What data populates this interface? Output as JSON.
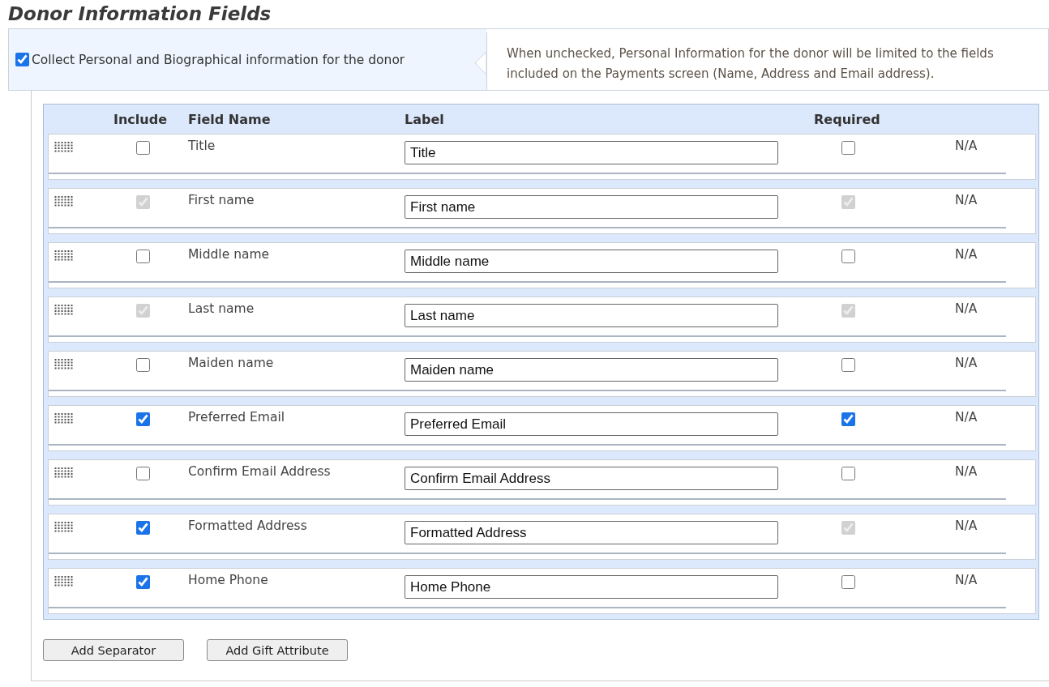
{
  "title": "Donor Information Fields",
  "collect_option": {
    "label": "Collect Personal and Biographical information for the donor",
    "checked": true
  },
  "collect_hint": "When unchecked, Personal Information for the donor will be limited to the fields included on the Payments screen (Name, Address and Email address).",
  "table": {
    "columns": [
      "Include",
      "Field Name",
      "Label",
      "Required"
    ],
    "rows": [
      {
        "field_name": "Title",
        "label": "Title",
        "include": {
          "checked": false,
          "disabled": false
        },
        "required": {
          "checked": false,
          "disabled": false
        },
        "column_5": "N/A"
      },
      {
        "field_name": "First name",
        "label": "First name",
        "include": {
          "checked": true,
          "disabled": true
        },
        "required": {
          "checked": true,
          "disabled": true
        },
        "column_5": "N/A"
      },
      {
        "field_name": "Middle name",
        "label": "Middle name",
        "include": {
          "checked": false,
          "disabled": false
        },
        "required": {
          "checked": false,
          "disabled": false
        },
        "column_5": "N/A"
      },
      {
        "field_name": "Last name",
        "label": "Last name",
        "include": {
          "checked": true,
          "disabled": true
        },
        "required": {
          "checked": true,
          "disabled": true
        },
        "column_5": "N/A"
      },
      {
        "field_name": "Maiden name",
        "label": "Maiden name",
        "include": {
          "checked": false,
          "disabled": false
        },
        "required": {
          "checked": false,
          "disabled": false
        },
        "column_5": "N/A"
      },
      {
        "field_name": "Preferred Email",
        "label": "Preferred Email",
        "include": {
          "checked": true,
          "disabled": false
        },
        "required": {
          "checked": true,
          "disabled": false
        },
        "column_5": "N/A"
      },
      {
        "field_name": "Confirm Email Address",
        "label": "Confirm Email Address",
        "include": {
          "checked": false,
          "disabled": false
        },
        "required": {
          "checked": false,
          "disabled": false
        },
        "column_5": "N/A"
      },
      {
        "field_name": "Formatted Address",
        "label": "Formatted Address",
        "include": {
          "checked": true,
          "disabled": false
        },
        "required": {
          "checked": true,
          "disabled": true
        },
        "column_5": "N/A"
      },
      {
        "field_name": "Home Phone",
        "label": "Home Phone",
        "include": {
          "checked": true,
          "disabled": false
        },
        "required": {
          "checked": false,
          "disabled": false
        },
        "column_5": "N/A"
      }
    ]
  },
  "buttons": [
    "Add Separator",
    "Add Gift Attribute"
  ]
}
